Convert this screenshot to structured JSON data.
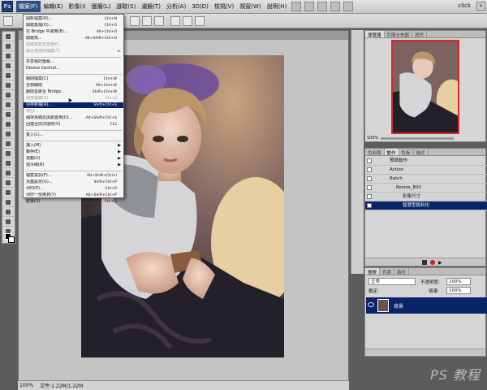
{
  "menubar": {
    "logo": "Ps",
    "items": [
      "檔案(F)",
      "編輯(E)",
      "影像(I)",
      "圖層(L)",
      "選取(S)",
      "濾鏡(T)",
      "分析(A)",
      "3D(D)",
      "檢視(V)",
      "視窗(W)",
      "說明(H)"
    ],
    "workspace_label": "click"
  },
  "file_menu": {
    "items": [
      {
        "label": "開新檔案(N)...",
        "shortcut": "Ctrl+N"
      },
      {
        "label": "開啟舊檔(O)...",
        "shortcut": "Ctrl+O"
      },
      {
        "label": "在 Bridge 中瀏覽(B)...",
        "shortcut": "Alt+Ctrl+O"
      },
      {
        "label": "開啟為...",
        "shortcut": "Alt+Shift+Ctrl+O"
      },
      {
        "label": "開啟為智慧型物件...",
        "shortcut": ""
      },
      {
        "label": "最近使用的檔案(T)",
        "shortcut": ""
      },
      {
        "label": "共享我的螢幕...",
        "shortcut": ""
      },
      {
        "label": "Device Central...",
        "shortcut": ""
      },
      {
        "label": "關閉檔案(C)",
        "shortcut": "Ctrl+W"
      },
      {
        "label": "全部關閉",
        "shortcut": "Alt+Ctrl+W"
      },
      {
        "label": "關閉並跳至 Bridge...",
        "shortcut": "Shift+Ctrl+W"
      },
      {
        "label": "儲存檔案(S)",
        "shortcut": "Ctrl+S"
      },
      {
        "label": "另存新檔(A)...",
        "shortcut": "Shift+Ctrl+S"
      },
      {
        "label": "存回...",
        "shortcut": ""
      },
      {
        "label": "儲存為網頁與裝置用(D)...",
        "shortcut": "Alt+Shift+Ctrl+S"
      },
      {
        "label": "回復至前次儲存(V)",
        "shortcut": "F12"
      },
      {
        "label": "置入(L)...",
        "shortcut": ""
      },
      {
        "label": "讀入(M)",
        "shortcut": ""
      },
      {
        "label": "轉存(E)",
        "shortcut": ""
      },
      {
        "label": "自動(U)",
        "shortcut": ""
      },
      {
        "label": "指令碼(R)",
        "shortcut": ""
      },
      {
        "label": "檔案資訊(F)...",
        "shortcut": "Alt+Shift+Ctrl+I"
      },
      {
        "label": "頁面設定(G)...",
        "shortcut": "Shift+Ctrl+P"
      },
      {
        "label": "列印(P)...",
        "shortcut": "Ctrl+P"
      },
      {
        "label": "列印一份拷貝(Y)",
        "shortcut": "Alt+Shift+Ctrl+P"
      },
      {
        "label": "結束(X)",
        "shortcut": "Ctrl+Q"
      }
    ],
    "highlighted_index": 12,
    "disabled_indexes": [
      4,
      5,
      11,
      13
    ]
  },
  "status": {
    "zoom": "100%",
    "doc_info": "文件:1.22M/1.22M"
  },
  "navigator_panel": {
    "tabs": [
      "導覽器",
      "色階分佈圖",
      "資訊"
    ],
    "zoom": "100%"
  },
  "actions_panel": {
    "tabs": [
      "色彩庫",
      "動作",
      "色板",
      "樣式"
    ],
    "rows": [
      {
        "label": "預設動作"
      },
      {
        "label": "Action"
      },
      {
        "label": "Batch"
      },
      {
        "label": "Resize_800"
      },
      {
        "label": "影像尺寸"
      },
      {
        "label": "智慧型銳利化"
      }
    ]
  },
  "layers_panel": {
    "tabs": [
      "圖層",
      "色版",
      "路徑"
    ],
    "blend_mode": "正常",
    "opacity_label": "不透明度:",
    "opacity_value": "100%",
    "lock_label": "鎖定:",
    "fill_label": "填滿:",
    "fill_value": "100%",
    "layer_name": "背景"
  },
  "watermark": "PS 教程"
}
